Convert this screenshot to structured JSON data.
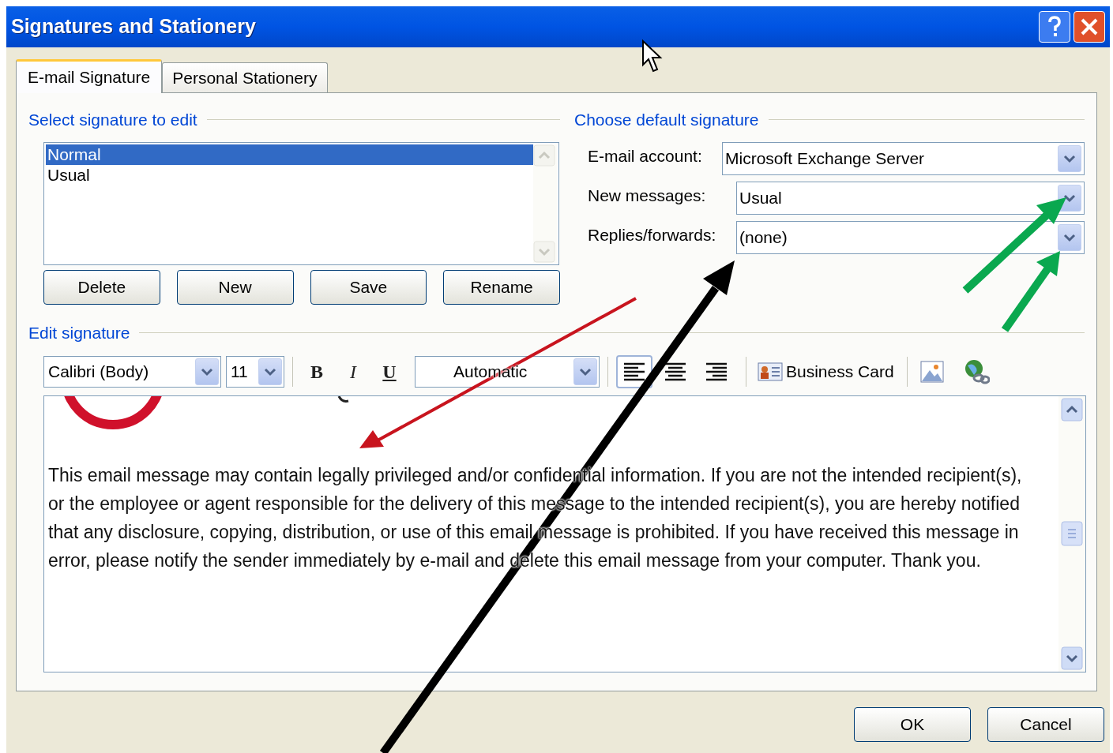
{
  "window": {
    "title": "Signatures and Stationery"
  },
  "tabs": [
    {
      "label": "E-mail Signature",
      "selected": true
    },
    {
      "label": "Personal Stationery",
      "selected": false
    }
  ],
  "select_section": {
    "heading": "Select signature to edit",
    "signatures": [
      {
        "label": "Normal",
        "selected": true
      },
      {
        "label": "Usual",
        "selected": false
      }
    ],
    "buttons": [
      "Delete",
      "New",
      "Save",
      "Rename"
    ]
  },
  "default_section": {
    "heading": "Choose default signature",
    "fields": [
      {
        "label": "E-mail account:",
        "value": "Microsoft Exchange Server"
      },
      {
        "label": "New messages:",
        "value": "Usual"
      },
      {
        "label": "Replies/forwards:",
        "value": "(none)"
      }
    ]
  },
  "edit_section": {
    "heading": "Edit signature",
    "font": "Calibri (Body)",
    "size": "11",
    "styles": [
      {
        "label": "B",
        "kind": "bold"
      },
      {
        "label": "I",
        "kind": "italic"
      },
      {
        "label": "U",
        "kind": "underline"
      }
    ],
    "font_color_label": "Automatic",
    "alignments": [
      {
        "kind": "left",
        "selected": true
      },
      {
        "kind": "center",
        "selected": false
      },
      {
        "kind": "right",
        "selected": false
      }
    ],
    "business_card": "Business Card",
    "body": "This email message may contain legally privileged and/or confidential information. If you are not the intended recipient(s), or the employee or agent responsible for the delivery of this message to the intended recipient(s), you are hereby notified that any disclosure, copying, distribution, or use of this email message is prohibited. If you have received this message in error, please notify the sender immediately by e-mail and delete this email message from your computer. Thank you."
  },
  "buttons": [
    "OK",
    "Cancel"
  ]
}
